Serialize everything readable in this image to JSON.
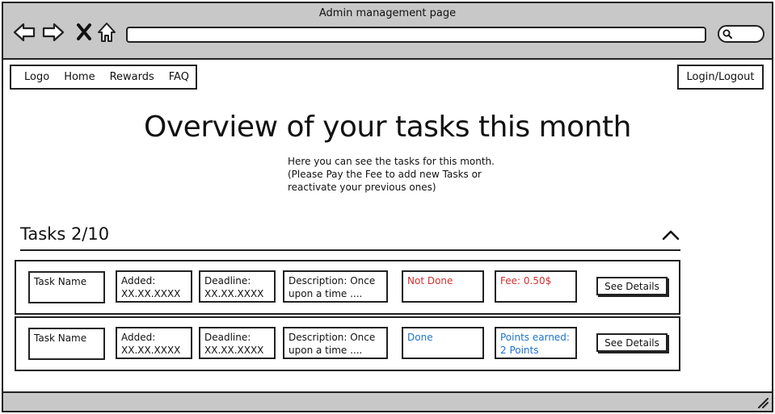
{
  "browser": {
    "title": "Admin management page",
    "address_value": ""
  },
  "nav": {
    "items": [
      "Logo",
      "Home",
      "Rewards",
      "FAQ"
    ],
    "login_label": "Login/Logout"
  },
  "page": {
    "title": "Overview of your tasks this month",
    "intro": [
      "Here you can see the tasks for this month.",
      "(Please Pay the Fee to add new Tasks or",
      "reactivate your previous ones)"
    ]
  },
  "tasks": {
    "heading": "Tasks 2/10",
    "rows": [
      {
        "name": "Task Name",
        "added": [
          "Added:",
          "XX.XX.XXXX"
        ],
        "deadline": [
          "Deadline:",
          "XX.XX.XXXX"
        ],
        "description": [
          "Description: Once",
          "upon a time ...."
        ],
        "status": "Not Done",
        "info": [
          "Fee: 0.50$"
        ],
        "details_label": "See Details"
      },
      {
        "name": "Task Name",
        "added": [
          "Added:",
          "XX.XX.XXXX"
        ],
        "deadline": [
          "Deadline:",
          "XX.XX.XXXX"
        ],
        "description": [
          "Description: Once",
          "upon a time ...."
        ],
        "status": "Done",
        "info": [
          "Points earned:",
          "2 Points"
        ],
        "details_label": "See Details"
      }
    ]
  },
  "colors": {
    "not_done": "#d32f2f",
    "done": "#1e73d0",
    "chrome": "#c8c8c8"
  },
  "icons": {
    "back": "back-arrow-icon",
    "forward": "forward-arrow-icon",
    "close": "close-icon",
    "home": "home-icon",
    "search": "search-icon",
    "collapse": "chevron-up-icon",
    "resize": "resize-grip-icon"
  }
}
